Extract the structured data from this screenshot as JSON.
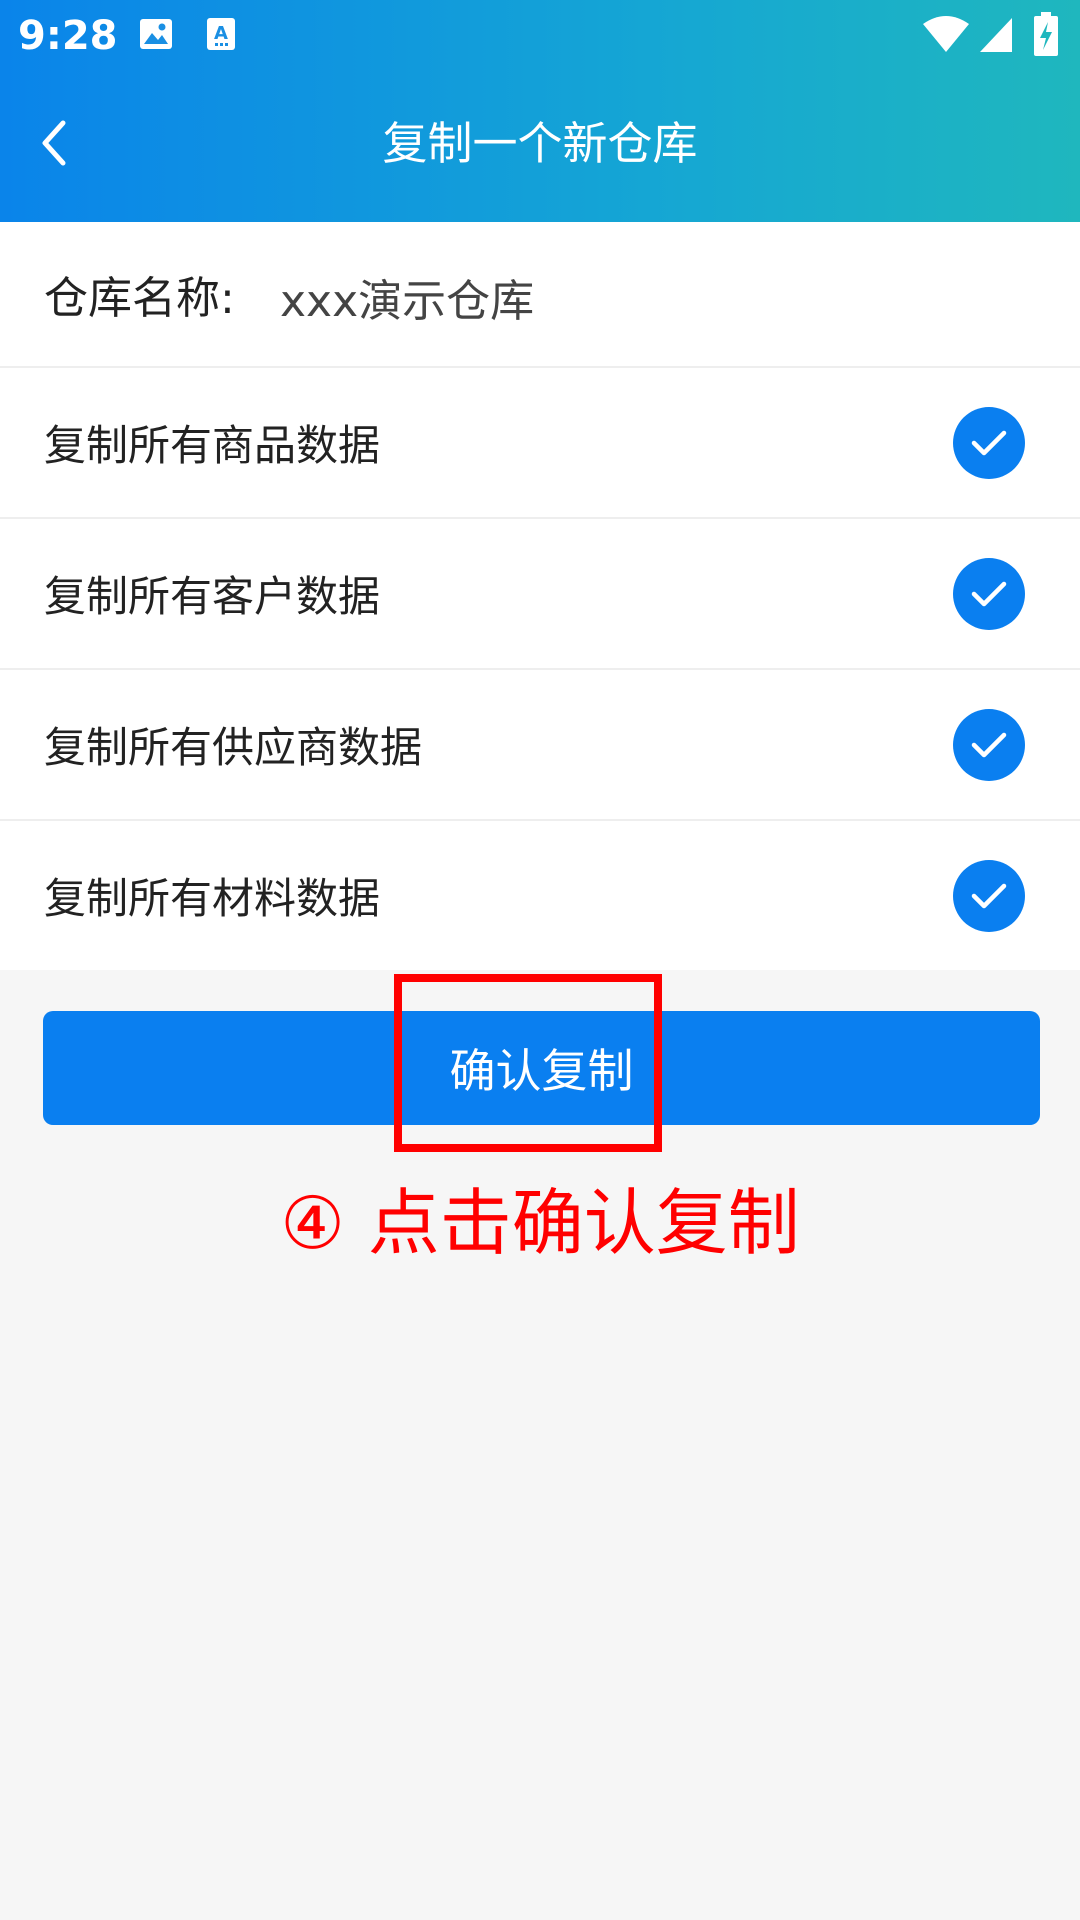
{
  "status_bar": {
    "time": "9:28",
    "icons": [
      "image-icon",
      "text-recognition-icon",
      "wifi-icon",
      "cellular-signal-icon",
      "battery-charging-icon"
    ]
  },
  "nav": {
    "back_icon": "chevron-left-icon",
    "title": "复制一个新仓库"
  },
  "form": {
    "name_label": "仓库名称:",
    "name_value": "xxx演示仓库",
    "options": [
      {
        "label": "复制所有商品数据",
        "checked": true
      },
      {
        "label": "复制所有客户数据",
        "checked": true
      },
      {
        "label": "复制所有供应商数据",
        "checked": true
      },
      {
        "label": "复制所有材料数据",
        "checked": true
      }
    ]
  },
  "confirm_button": {
    "label": "确认复制"
  },
  "annotation": {
    "text": "④ 点击确认复制"
  },
  "colors": {
    "header_start": "#0a84ea",
    "header_end": "#1fb7be",
    "accent": "#0a7ff0",
    "annotation": "#ff0000"
  }
}
